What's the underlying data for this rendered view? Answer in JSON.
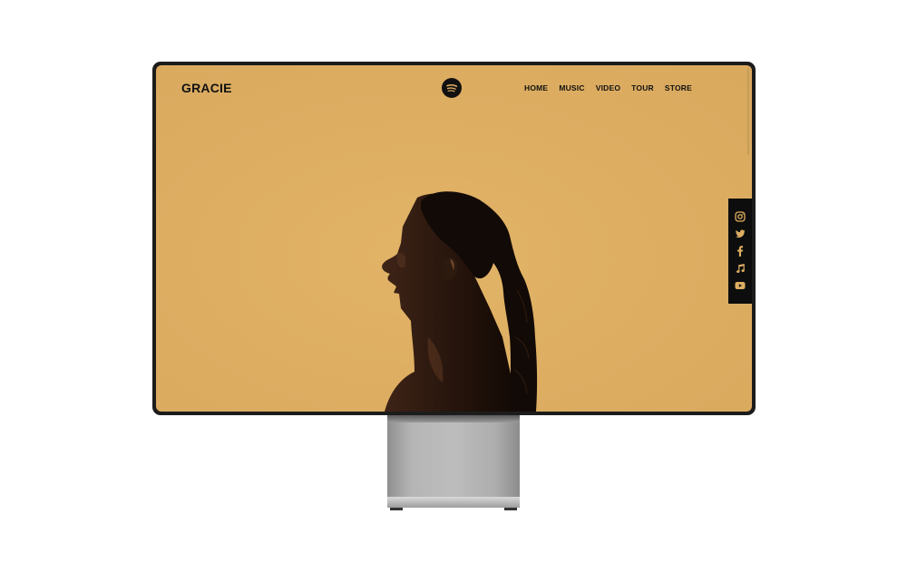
{
  "site": {
    "logo": "GRACIE",
    "nav": [
      {
        "label": "HOME"
      },
      {
        "label": "MUSIC"
      },
      {
        "label": "VIDEO"
      },
      {
        "label": "TOUR"
      },
      {
        "label": "STORE"
      }
    ],
    "header_icon": "spotify-icon",
    "social": [
      "instagram-icon",
      "twitter-icon",
      "facebook-icon",
      "music-note-icon",
      "youtube-icon"
    ]
  },
  "colors": {
    "background": "#DEAE62",
    "text": "#111111",
    "social_bar": "#0D0D0D",
    "social_icon": "#DEAE62"
  }
}
